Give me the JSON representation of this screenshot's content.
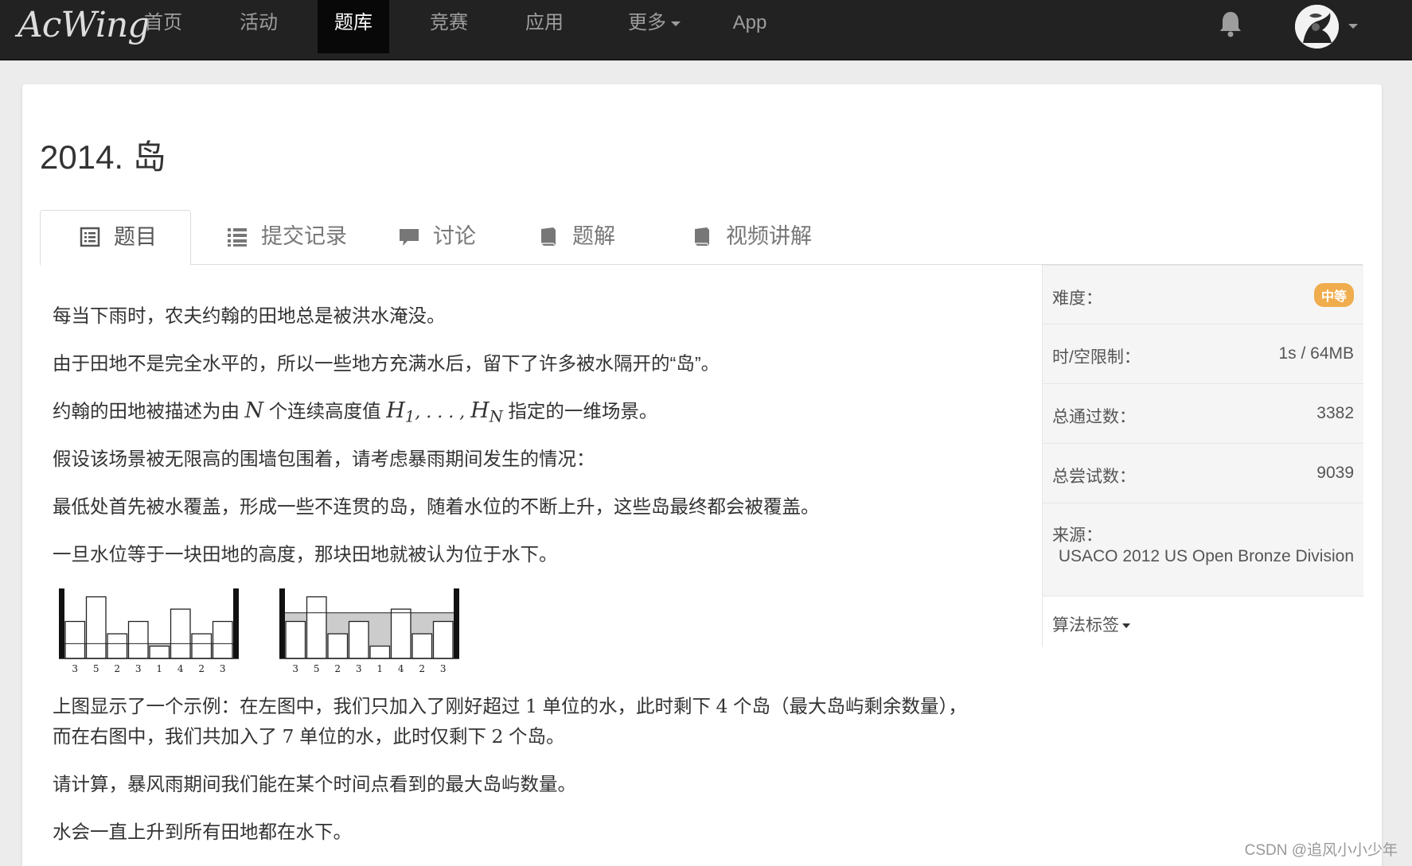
{
  "nav": {
    "brand": "AcWing",
    "items": [
      "首页",
      "活动",
      "题库",
      "竞赛",
      "应用",
      "更多",
      "App"
    ],
    "active": "题库"
  },
  "problem": {
    "title": "2014. 岛",
    "tabs": [
      "题目",
      "提交记录",
      "讨论",
      "题解",
      "视频讲解"
    ],
    "paragraphs": {
      "p1": "每当下雨时，农夫约翰的田地总是被洪水淹没。",
      "p2": "由于田地不是完全水平的，所以一些地方充满水后，留下了许多被水隔开的“岛”。",
      "p3a": "约翰的田地被描述为由 ",
      "p3N": "N",
      "p3b": " 个连续高度值 ",
      "p3H1": "H",
      "p3s1": "1",
      "p3dots": ", . . . , ",
      "p3HN": "H",
      "p3sN": "N",
      "p3c": " 指定的一维场景。",
      "p4": "假设该场景被无限高的围墙包围着，请考虑暴雨期间发生的情况：",
      "p5": "最低处首先被水覆盖，形成一些不连贯的岛，随着水位的不断上升，这些岛最终都会被覆盖。",
      "p6": "一旦水位等于一块田地的高度，那块田地就被认为位于水下。",
      "p7a": "上图显示了一个示例：在左图中，我们只加入了刚好超过 ",
      "p7n1": "1",
      "p7b": " 单位的水，此时剩下 ",
      "p7n2": "4",
      "p7c": " 个岛（最大岛屿剩余数量），",
      "p8a": "而在右图中，我们共加入了 ",
      "p8n1": "7",
      "p8b": " 单位的水，此时仅剩下 ",
      "p8n2": "2",
      "p8c": " 个岛。",
      "p9": "请计算，暴风雨期间我们能在某个时间点看到的最大岛屿数量。",
      "p10": "水会一直上升到所有田地都在水下。"
    },
    "figure": {
      "heights": [
        3,
        5,
        2,
        3,
        1,
        4,
        2,
        3
      ],
      "labels": [
        "3",
        "5",
        "2",
        "3",
        "1",
        "4",
        "2",
        "3"
      ],
      "left_water_level": 1.2,
      "right_water_level": 3.7
    }
  },
  "sidebar": {
    "difficulty_label": "难度：",
    "difficulty_value": "中等",
    "limit_label": "时/空限制：",
    "limit_value": "1s / 64MB",
    "passed_label": "总通过数：",
    "passed_value": "3382",
    "tried_label": "总尝试数：",
    "tried_value": "9039",
    "source_label": "来源：",
    "source_value": "USACO 2012 US Open Bronze Division",
    "tags_label": "算法标签"
  },
  "colors": {
    "navbar": "#222222",
    "badge": "#f0ad4e",
    "water": "#cccccc"
  },
  "watermark": "CSDN @追风小小少年"
}
